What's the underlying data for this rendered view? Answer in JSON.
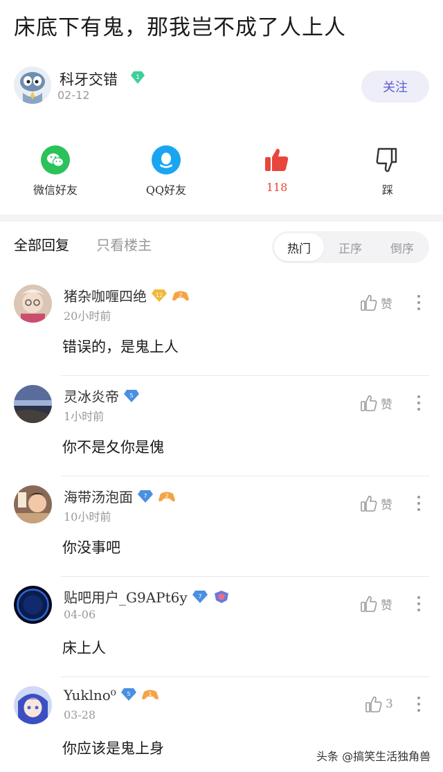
{
  "post": {
    "title": "床底下有鬼，那我岂不成了人上人",
    "author": {
      "name": "科牙交错",
      "level": "1",
      "date": "02-12"
    },
    "follow_label": "关注"
  },
  "share": {
    "wechat_label": "微信好友",
    "qq_label": "QQ好友",
    "like_count": "118",
    "dislike_label": "踩"
  },
  "tabs": {
    "all": "全部回复",
    "op_only": "只看楼主"
  },
  "sort": {
    "hot": "热门",
    "asc": "正序",
    "desc": "倒序",
    "selected": "热门"
  },
  "comments": [
    {
      "user": "猪杂咖喱四绝",
      "level": "12",
      "time": "20小时前",
      "text": "错误的，是鬼上人",
      "like": "赞"
    },
    {
      "user": "灵冰炎帝",
      "level": "5",
      "time": "1小时前",
      "text": "你不是夂你是傀",
      "like": "赞"
    },
    {
      "user": "海带汤泡面",
      "level": "7",
      "time": "10小时前",
      "text": "你没事吧",
      "like": "赞"
    },
    {
      "user": "贴吧用户_G9APt6y",
      "level": "7",
      "time": "04-06",
      "text": "床上人",
      "like": "赞"
    },
    {
      "user": "Yuklno⁰",
      "level": "5",
      "time": "03-28",
      "text": "你应该是鬼上身",
      "like": "3"
    }
  ],
  "watermark": "头条 @搞笑生活独角兽",
  "colors": {
    "accent": "#5b5bd6",
    "like_red": "#e8453c",
    "wechat_green": "#2bc25a",
    "qq_blue": "#1aa5f0",
    "level_diamond_green": "#3fcf9b",
    "level_diamond_blue": "#4a90e2",
    "level_diamond_gold": "#f3b73a"
  }
}
